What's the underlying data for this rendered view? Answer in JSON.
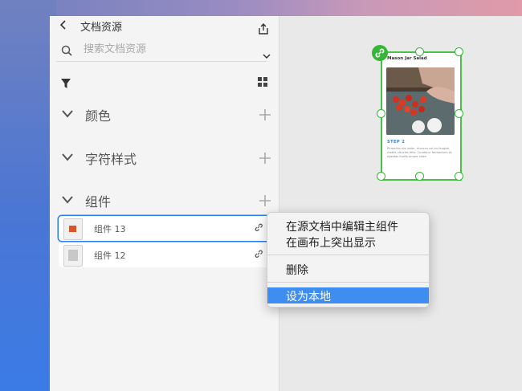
{
  "panel": {
    "title": "文档资源",
    "search_placeholder": "搜索文档资源",
    "sections": [
      {
        "label": "颜色"
      },
      {
        "label": "字符样式"
      },
      {
        "label": "组件"
      }
    ],
    "components": [
      {
        "label": "组件 13",
        "selected": true
      },
      {
        "label": "组件 12",
        "selected": false
      }
    ]
  },
  "context_menu": {
    "items": [
      "在源文档中编辑主组件",
      "在画布上突出显示",
      "删除",
      "设为本地"
    ],
    "highlighted": "设为本地"
  },
  "canvas_card": {
    "title": "Mason Jar Salad",
    "step": "STEP 2",
    "body": "Phasellus nisi dolor, rhoncus vel eu feugiat, mattis ultricies felis. Curabitur fermentum at, egestas mollis ornare vitae."
  },
  "colors": {
    "accent": "#2b7de9",
    "menu_highlight": "#3d8ef0",
    "selection_green": "#36b536"
  }
}
